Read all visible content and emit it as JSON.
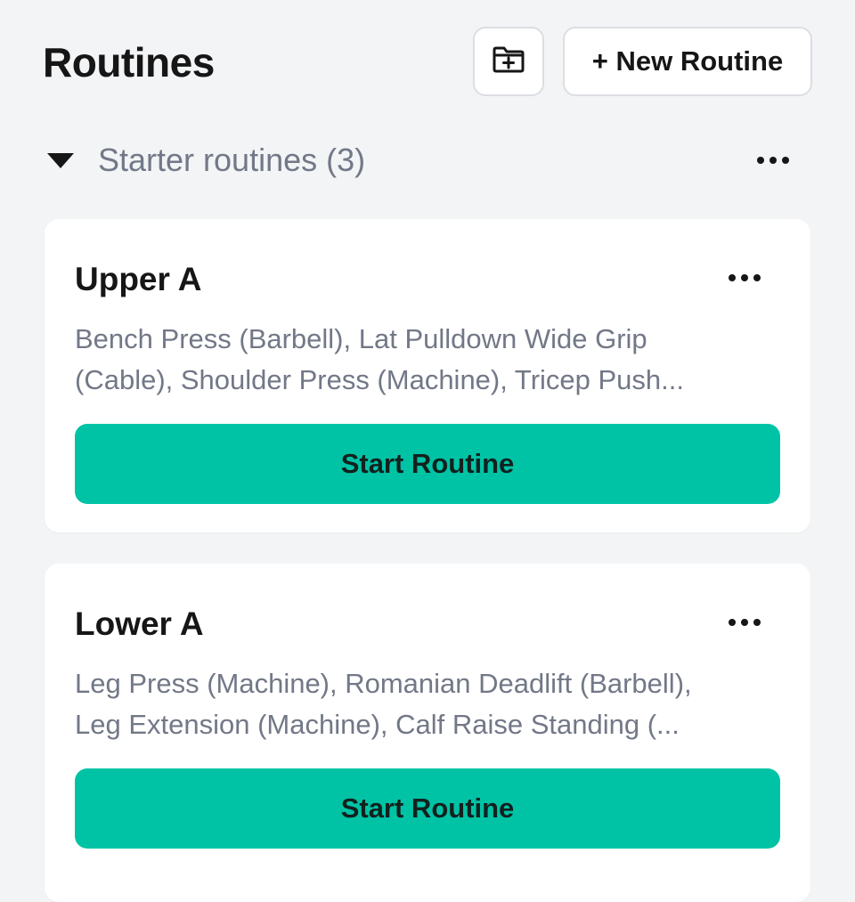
{
  "header": {
    "title": "Routines",
    "folder_button_icon": "folder-plus-icon",
    "new_routine_label": "+ New Routine"
  },
  "section": {
    "title": "Starter routines (3)",
    "collapse_icon": "triangle-down-icon",
    "more_icon": "more-horizontal-icon"
  },
  "routines": [
    {
      "name": "Upper A",
      "exercises_line1": "Bench Press (Barbell), Lat Pulldown Wide Grip",
      "exercises_line2": "(Cable), Shoulder Press (Machine), Tricep Push...",
      "start_label": "Start Routine"
    },
    {
      "name": "Lower A",
      "exercises_line1": "Leg Press (Machine), Romanian Deadlift (Barbell),",
      "exercises_line2": "Leg Extension (Machine), Calf Raise Standing (...",
      "start_label": "Start Routine"
    }
  ],
  "colors": {
    "background": "#f3f4f6",
    "card": "#ffffff",
    "accent": "#00c3a5",
    "muted_text": "#727887",
    "primary_text": "#161616"
  }
}
